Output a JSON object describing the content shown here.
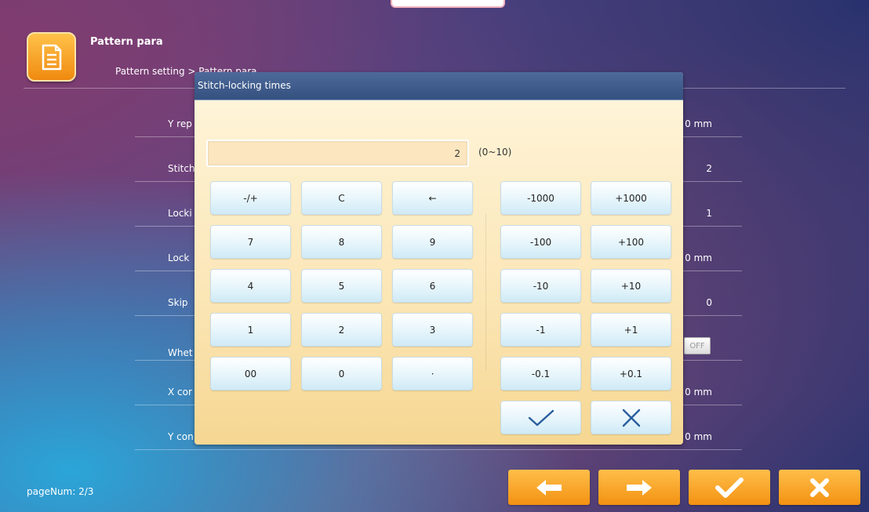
{
  "header": {
    "title": "Pattern para",
    "breadcrumb": "Pattern setting > Pattern para",
    "app_icon": "document-icon"
  },
  "params": [
    {
      "label": "Y rep",
      "value": "0 mm"
    },
    {
      "label": "Stitch",
      "value": "2"
    },
    {
      "label": "Locki",
      "value": "1"
    },
    {
      "label": "Lock",
      "value": "0 mm"
    },
    {
      "label": "Skip",
      "value": "0"
    },
    {
      "label": "Whet",
      "value": "OFF"
    },
    {
      "label": "X cor",
      "value": "0 mm"
    },
    {
      "label": "Y con",
      "value": "0 mm"
    }
  ],
  "page_num": "pageNum: 2/3",
  "footer": {
    "prev_icon": "arrow-left-icon",
    "next_icon": "arrow-right-icon",
    "confirm_icon": "checkmark-icon",
    "cancel_icon": "close-icon"
  },
  "dialog": {
    "title": "Stitch-locking times",
    "value": "2",
    "range": "(0~10)",
    "numpad": [
      [
        "-/+",
        "C",
        "←"
      ],
      [
        "7",
        "8",
        "9"
      ],
      [
        "4",
        "5",
        "6"
      ],
      [
        "1",
        "2",
        "3"
      ],
      [
        "00",
        "0",
        "·"
      ]
    ],
    "adjust": [
      [
        "-1000",
        "+1000"
      ],
      [
        "-100",
        "+100"
      ],
      [
        "-10",
        "+10"
      ],
      [
        "-1",
        "+1"
      ],
      [
        "-0.1",
        "+0.1"
      ]
    ],
    "ok_icon": "checkmark-icon",
    "cancel_icon": "close-icon"
  },
  "colors": {
    "accent_orange": "#f39212",
    "dialog_header": "#34507f",
    "key_blue": "#cfeaf6"
  }
}
